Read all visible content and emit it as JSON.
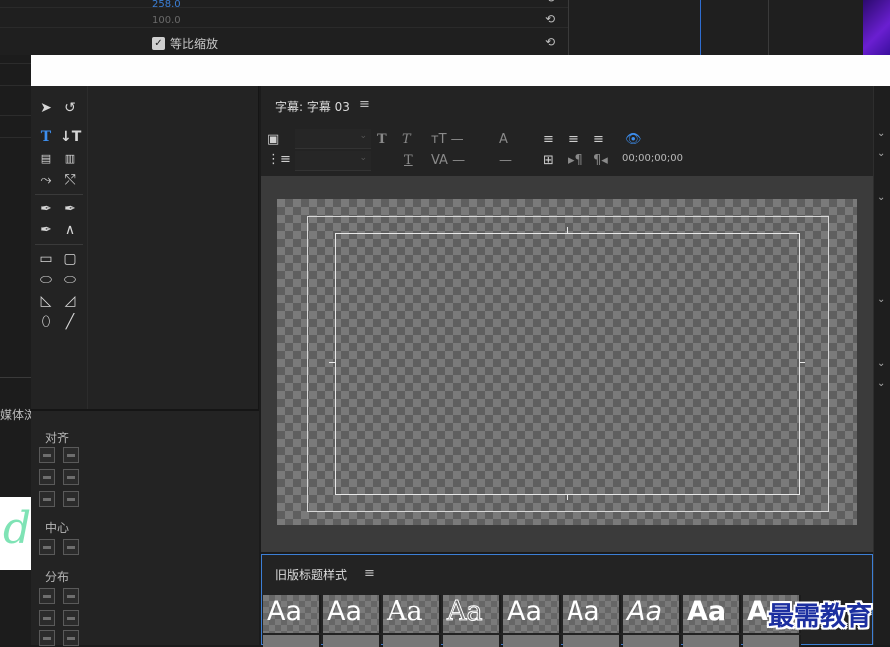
{
  "effect_controls": {
    "value_1": "258.0",
    "value_2": "100.0",
    "uniform_scale_label": "等比缩放"
  },
  "media_label": "媒体浏",
  "title_panel": {
    "tab_label": "字幕: 字幕 03",
    "menu_icon": "≡",
    "timecode": "00;00;00;00"
  },
  "align_panel": {
    "align_label": "对齐",
    "center_label": "中心",
    "distribute_label": "分布"
  },
  "styles_panel": {
    "tab_label": "旧版标题样式",
    "menu_icon": "≡",
    "swatches": [
      "Aa",
      "Aa",
      "Aa",
      "Aa",
      "Aa",
      "Aa",
      "Aa",
      "Aa",
      "A"
    ]
  },
  "watermark": "最需教育",
  "colors": {
    "accent_blue": "#3d8ff0",
    "panel_bg": "#232323",
    "stage_bg": "#3b3b3b"
  }
}
